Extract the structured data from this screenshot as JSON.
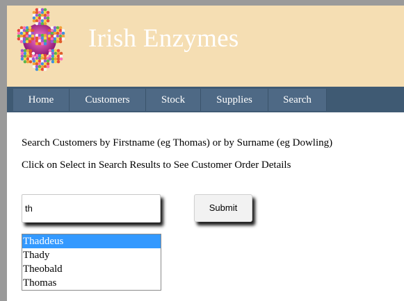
{
  "header": {
    "title": "Irish Enzymes",
    "logo_icon": "molecule-sphere-icon",
    "background_color": "#f5deb3"
  },
  "nav": {
    "items": [
      {
        "label": "Home"
      },
      {
        "label": "Customers"
      },
      {
        "label": "Stock"
      },
      {
        "label": "Supplies"
      },
      {
        "label": "Search"
      }
    ],
    "background_color": "#3f5a73",
    "item_color": "#4e6985"
  },
  "main": {
    "instruction_1": "Search Customers by Firstname (eg Thomas) or by Surname (eg Dowling)",
    "instruction_2": "Click on Select in Search Results to See Customer Order Details",
    "search": {
      "value": "th"
    },
    "submit_label": "Submit",
    "results": {
      "items": [
        "Thaddeus",
        "Thady",
        "Theobald",
        "Thomas"
      ],
      "selected": "Thaddeus",
      "selection_color": "#3399ff"
    }
  }
}
